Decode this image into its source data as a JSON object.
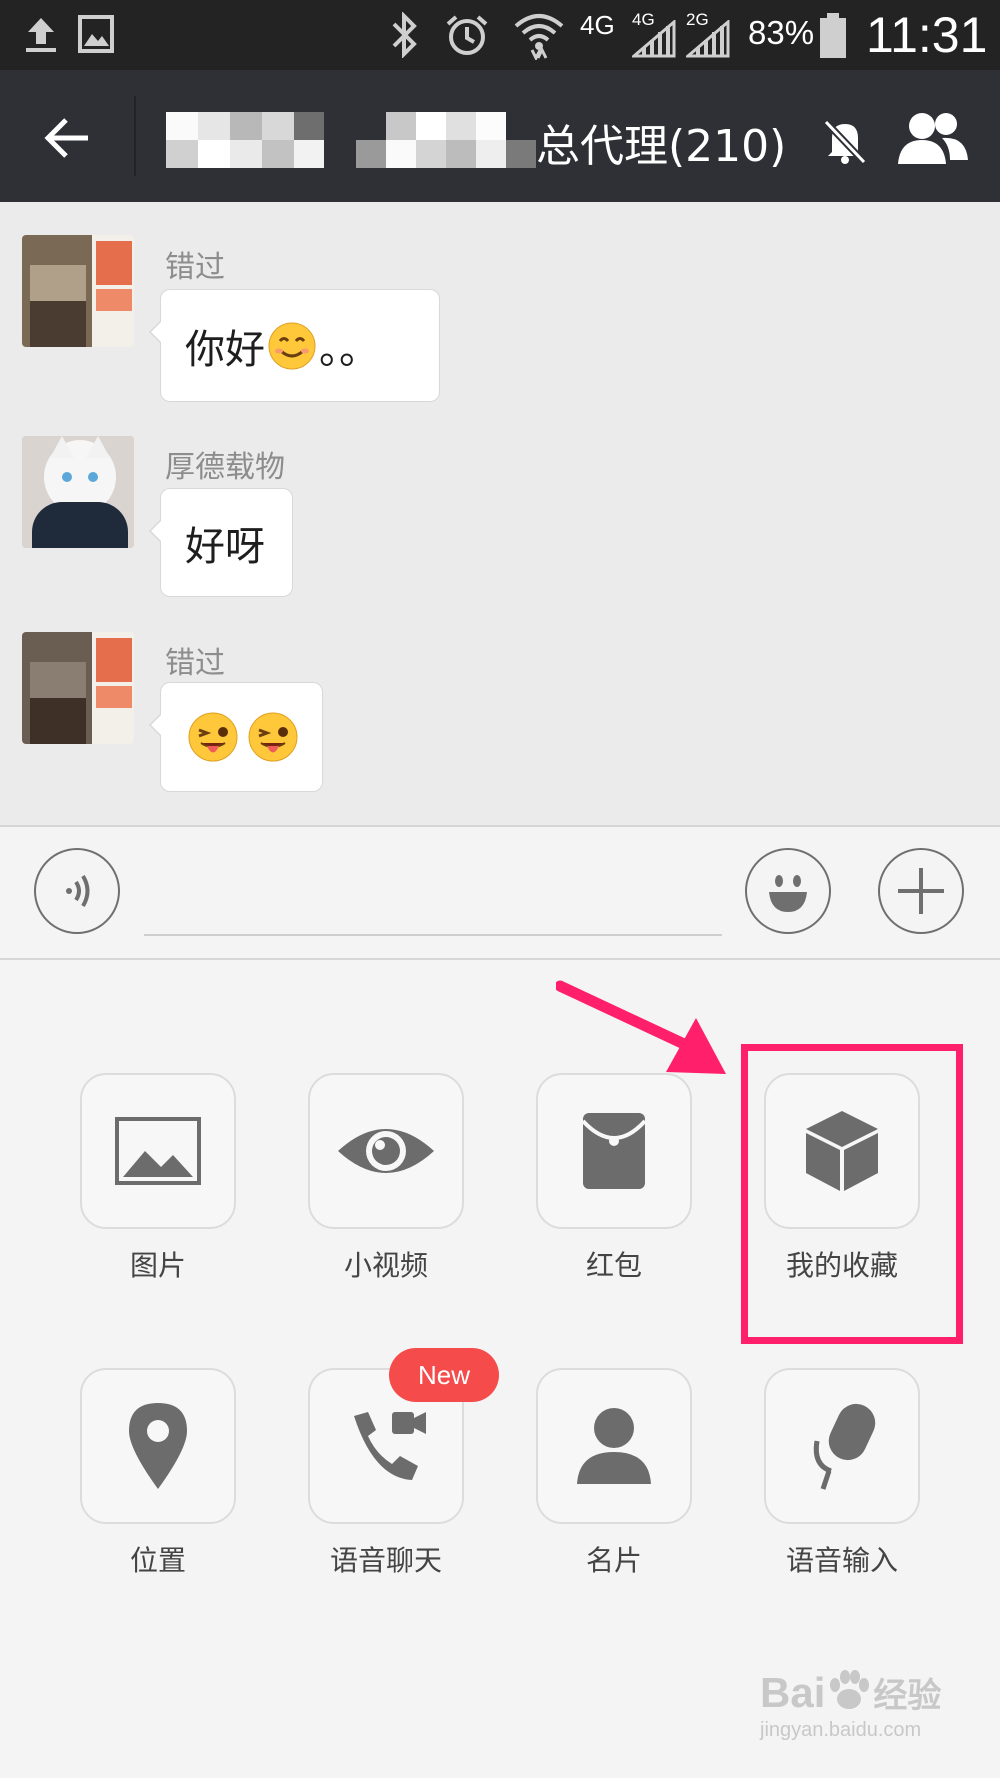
{
  "status_bar": {
    "network_4g": "4G",
    "sim1": "4G",
    "sim2": "2G",
    "battery": "83%",
    "time": "11:31"
  },
  "header": {
    "title": "总代理(210)"
  },
  "messages": [
    {
      "sender": "错过",
      "text": "你好",
      "suffix": "。。"
    },
    {
      "sender": "厚德载物",
      "text": "好呀"
    },
    {
      "sender": "错过",
      "text": ""
    }
  ],
  "panel": {
    "items": [
      {
        "label": "图片",
        "icon": "image-icon"
      },
      {
        "label": "小视频",
        "icon": "eye-icon"
      },
      {
        "label": "红包",
        "icon": "red-packet-icon"
      },
      {
        "label": "我的收藏",
        "icon": "cube-icon"
      },
      {
        "label": "位置",
        "icon": "location-pin-icon"
      },
      {
        "label": "语音聊天",
        "icon": "phone-video-icon",
        "badge": "New"
      },
      {
        "label": "名片",
        "icon": "person-icon"
      },
      {
        "label": "语音输入",
        "icon": "microphone-icon"
      }
    ]
  },
  "colors": {
    "highlight": "#ff1f6a",
    "arrow": "#ff1f6a",
    "badge": "#f54b4b"
  },
  "watermark": {
    "line1": "Bai",
    "line1b": "经验",
    "line2": "jingyan.baidu.com"
  }
}
